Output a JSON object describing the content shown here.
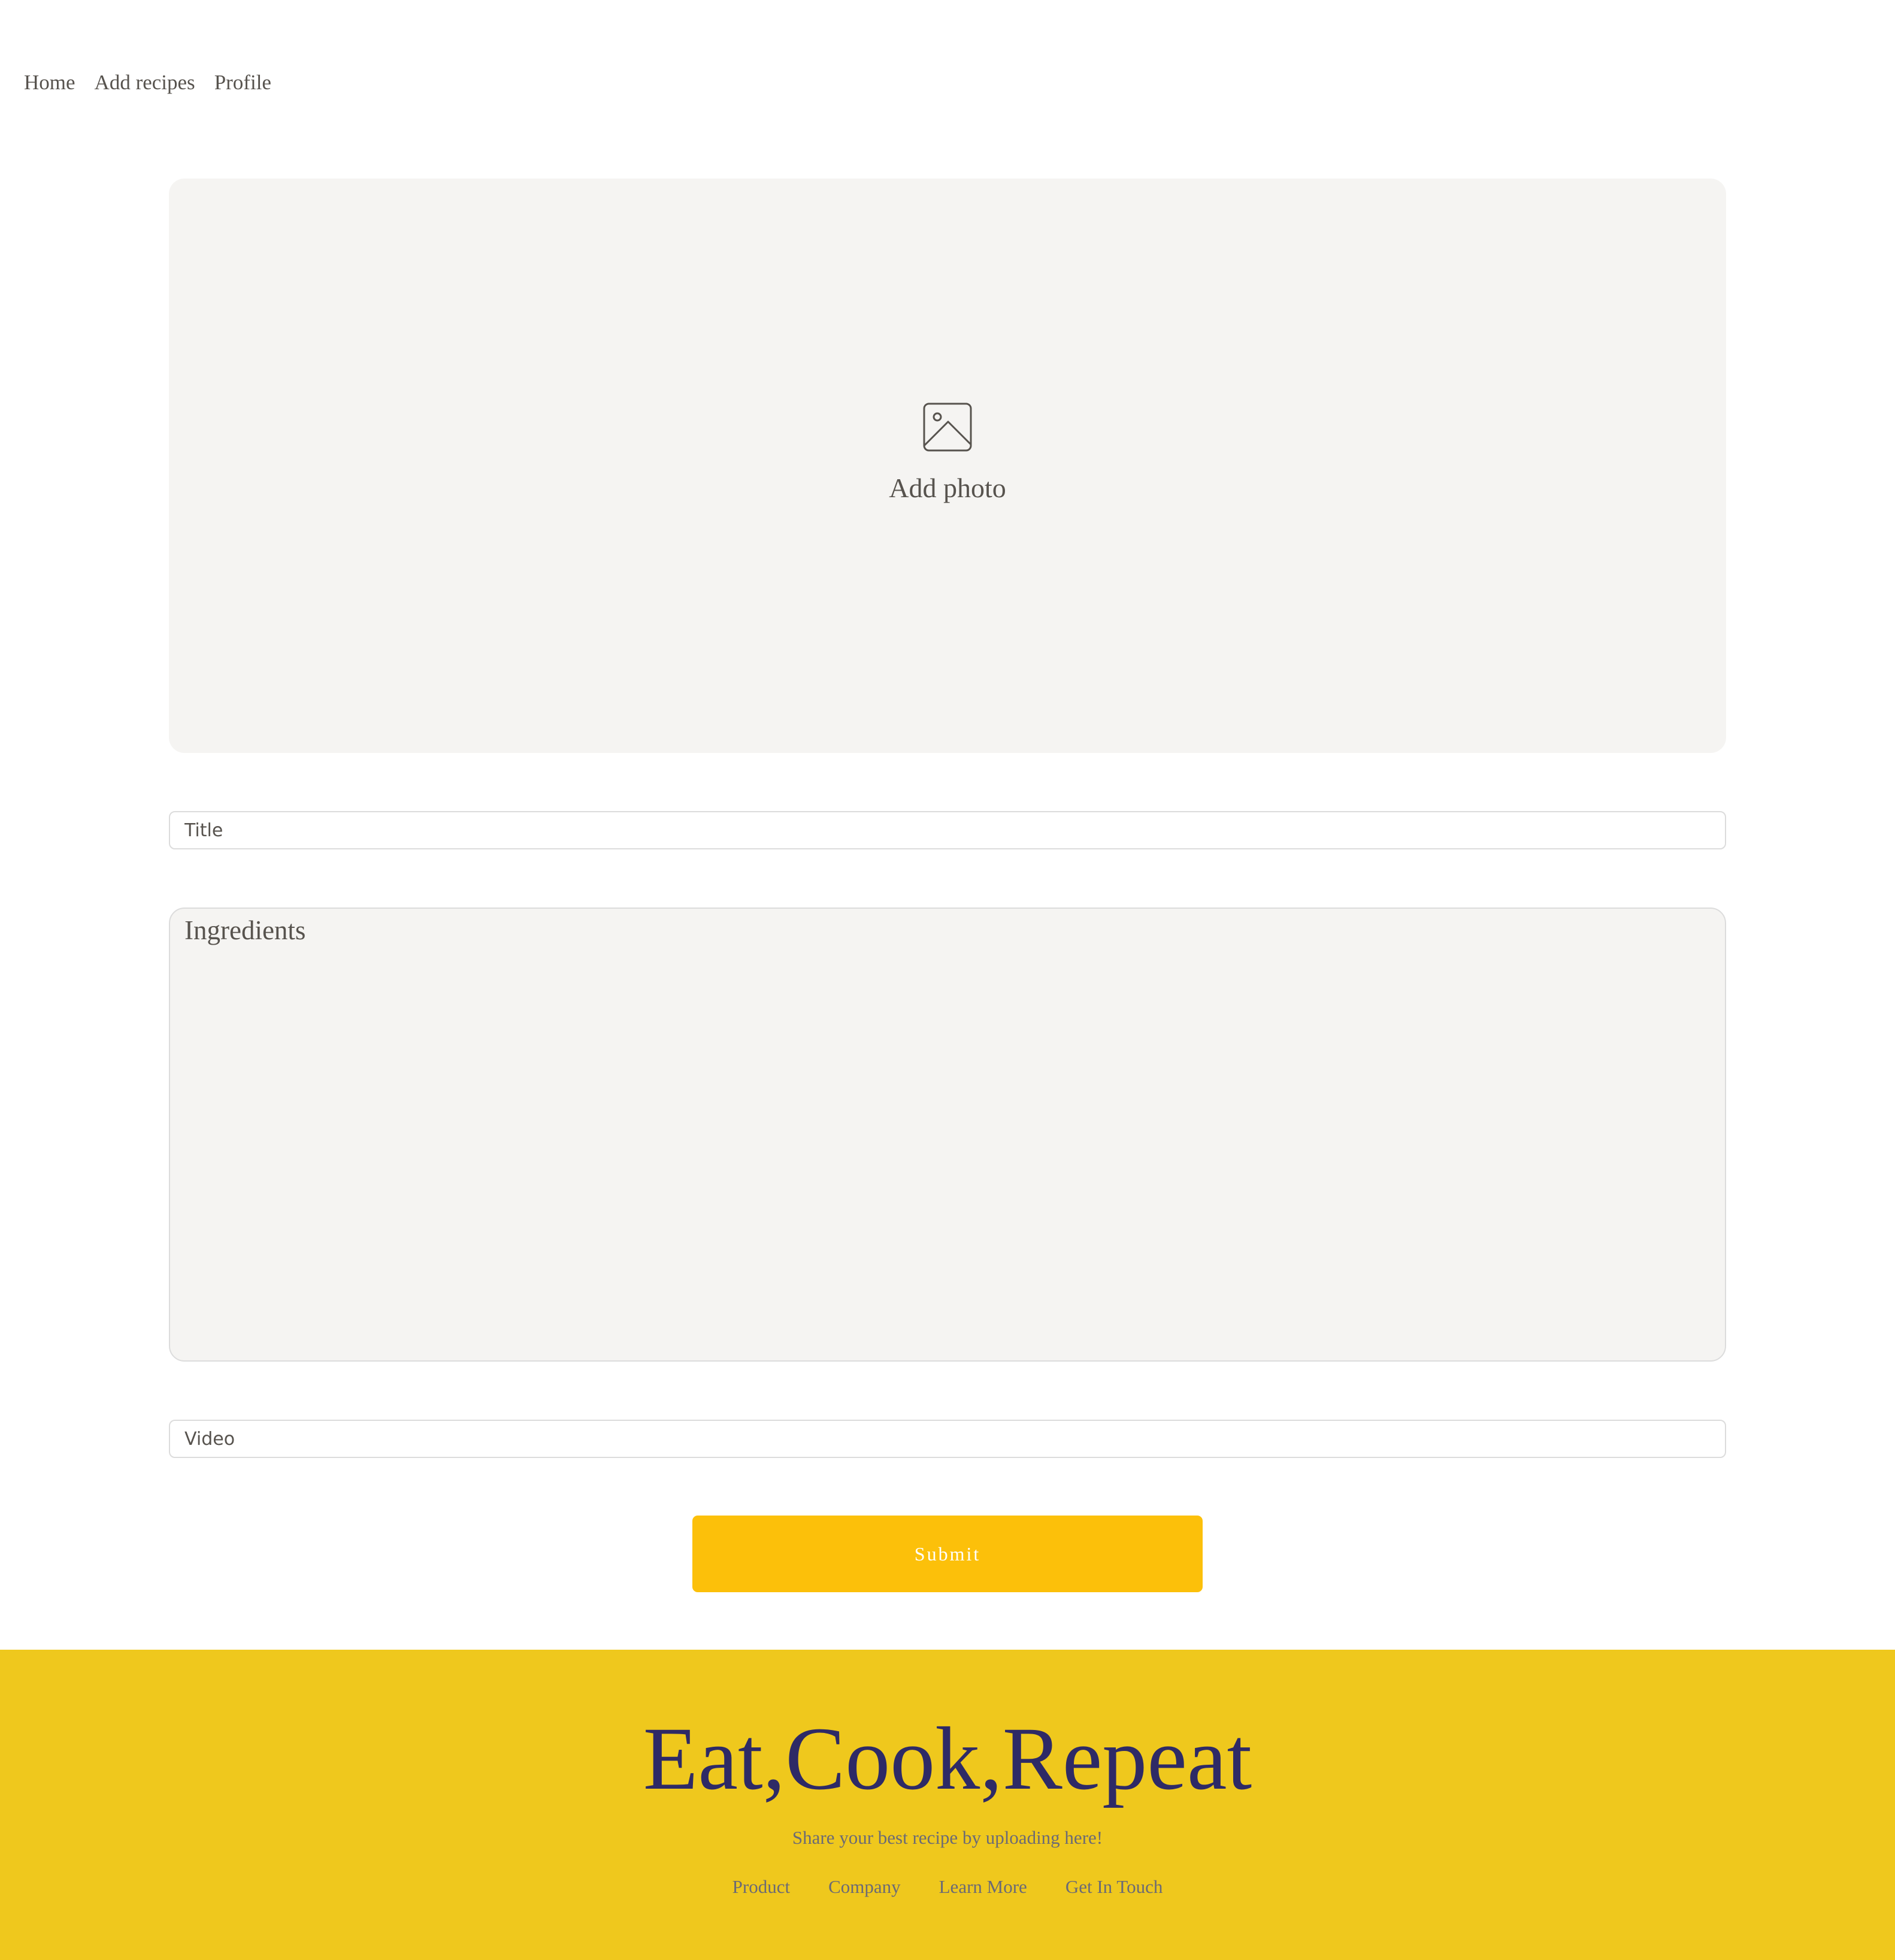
{
  "nav": {
    "items": [
      {
        "label": "Home"
      },
      {
        "label": "Add recipes"
      },
      {
        "label": "Profile"
      }
    ]
  },
  "form": {
    "photo": {
      "icon": "image-icon",
      "label": "Add photo"
    },
    "title": {
      "placeholder": "Title",
      "value": ""
    },
    "ingredients": {
      "placeholder": "Ingredients",
      "value": ""
    },
    "video": {
      "placeholder": "Video",
      "value": ""
    },
    "submit_label": "Submit"
  },
  "footer": {
    "title": "Eat,Cook,Repeat",
    "subtitle": "Share your best recipe by uploading here!",
    "links": [
      {
        "label": "Product"
      },
      {
        "label": "Company"
      },
      {
        "label": "Learn More"
      },
      {
        "label": "Get In Touch"
      }
    ]
  },
  "colors": {
    "accent": "#fcc00a",
    "footer_bg": "#efc81d",
    "footer_title": "#2e2a66",
    "panel_bg": "#f5f4f2",
    "text": "#57534e"
  }
}
